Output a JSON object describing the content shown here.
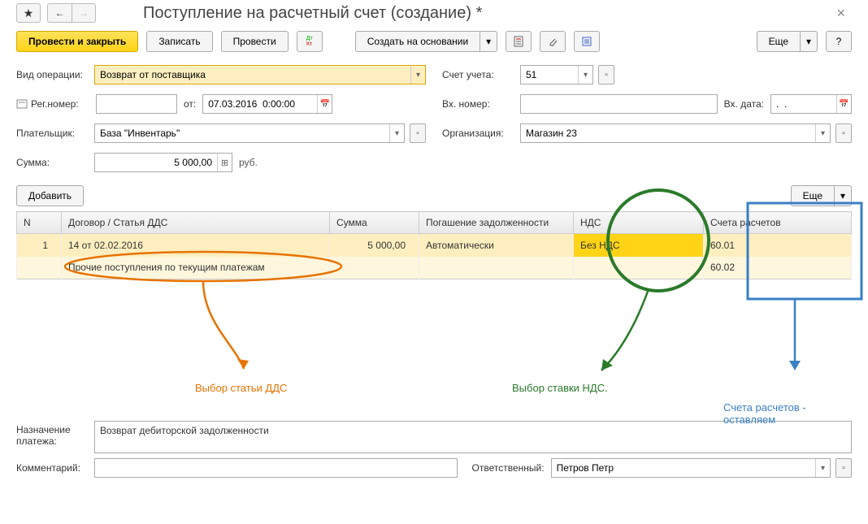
{
  "header": {
    "title": "Поступление на расчетный счет (создание) *"
  },
  "toolbar": {
    "post_close": "Провести и закрыть",
    "save": "Записать",
    "post": "Провести",
    "create_based": "Создать на основании",
    "more": "Еще"
  },
  "form": {
    "op_type_label": "Вид операции:",
    "op_type": "Возврат от поставщика",
    "account_label": "Счет учета:",
    "account": "51",
    "regnum_label": "Рег.номер:",
    "regnum": "",
    "from_label": "от:",
    "from_date": "07.03.2016  0:00:00",
    "innum_label": "Вх. номер:",
    "innum": "",
    "indate_label": "Вх. дата:",
    "indate": ".  .",
    "payer_label": "Плательщик:",
    "payer": "База \"Инвентарь\"",
    "org_label": "Организация:",
    "org": "Магазин 23",
    "sum_label": "Сумма:",
    "sum": "5 000,00",
    "currency": "руб.",
    "add_btn": "Добавить",
    "purpose_label": "Назначение платежа:",
    "purpose": "Возврат дебиторской задолженности",
    "comment_label": "Комментарий:",
    "comment": "",
    "resp_label": "Ответственный:",
    "resp": "Петров Петр"
  },
  "table": {
    "headers": {
      "n": "N",
      "contract": "Договор / Статья ДДС",
      "sum": "Сумма",
      "debt": "Погашение задолженности",
      "vat": "НДС",
      "accounts": "Счета расчетов"
    },
    "rows": [
      {
        "n": "1",
        "contract": "14 от 02.02.2016",
        "sum": "5 000,00",
        "debt": "Автоматически",
        "vat": "Без НДС",
        "acc": "60.01"
      },
      {
        "contract": "Прочие поступления по текущим платежам",
        "acc": "60.02"
      }
    ]
  },
  "annotations": {
    "dds": "Выбор статьи ДДС",
    "vat": "Выбор ставки НДС.",
    "acc": "Счета расчетов - оставляем"
  }
}
